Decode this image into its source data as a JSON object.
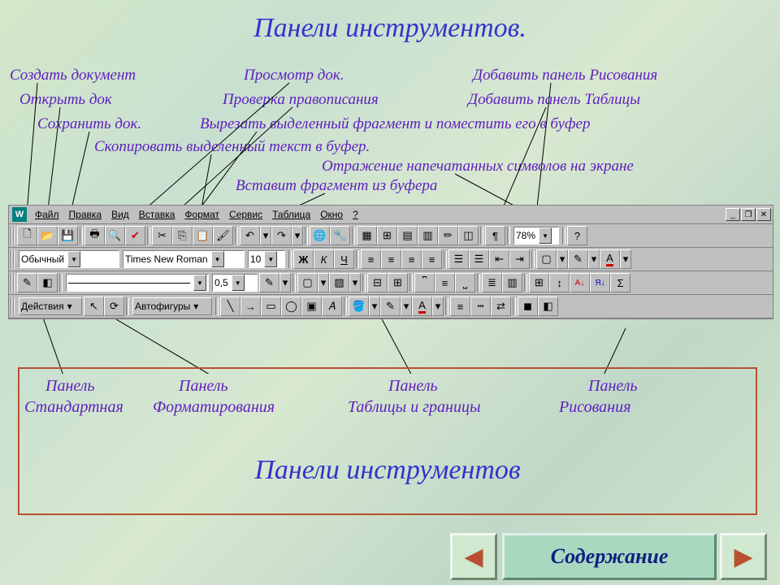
{
  "title": "Панели инструментов.",
  "annotations": {
    "create_doc": "Создать документ",
    "open_doc": "Открыть док",
    "save_doc": "Сохранить док.",
    "copy_buf": "Скопировать выделенный текст в буфер.",
    "preview": "Просмотр док.",
    "spellcheck": "Проверка правописания",
    "cut_buf": "Вырезать выделенный фрагмент и поместить его в буфер",
    "add_draw": "Добавить панель Рисования",
    "add_table": "Добавить панель Таблицы",
    "show_nonprint": "Отражение напечатанных символов на экране",
    "paste_buf": "Вставит фрагмент из буфера"
  },
  "menubar": {
    "items": [
      "Файл",
      "Правка",
      "Вид",
      "Вставка",
      "Формат",
      "Сервис",
      "Таблица",
      "Окно",
      "?"
    ]
  },
  "standard_tb": {
    "zoom": "78%"
  },
  "format_tb": {
    "style": "Обычный",
    "font": "Times New Roman",
    "size": "10",
    "bold": "Ж",
    "italic": "К",
    "underline": "Ч"
  },
  "tables_tb": {
    "weight": "0,5"
  },
  "draw_tb": {
    "actions": "Действия",
    "autoshapes": "Автофигуры"
  },
  "bottom": {
    "col1a": "Панель",
    "col1b": "Стандартная",
    "col2a": "Панель",
    "col2b": "Форматирования",
    "col3a": "Панель",
    "col3b": "Таблицы и границы",
    "col4a": "Панель",
    "col4b": "Рисования",
    "title": "Панели инструментов"
  },
  "nav": {
    "toc": "Содержание"
  }
}
